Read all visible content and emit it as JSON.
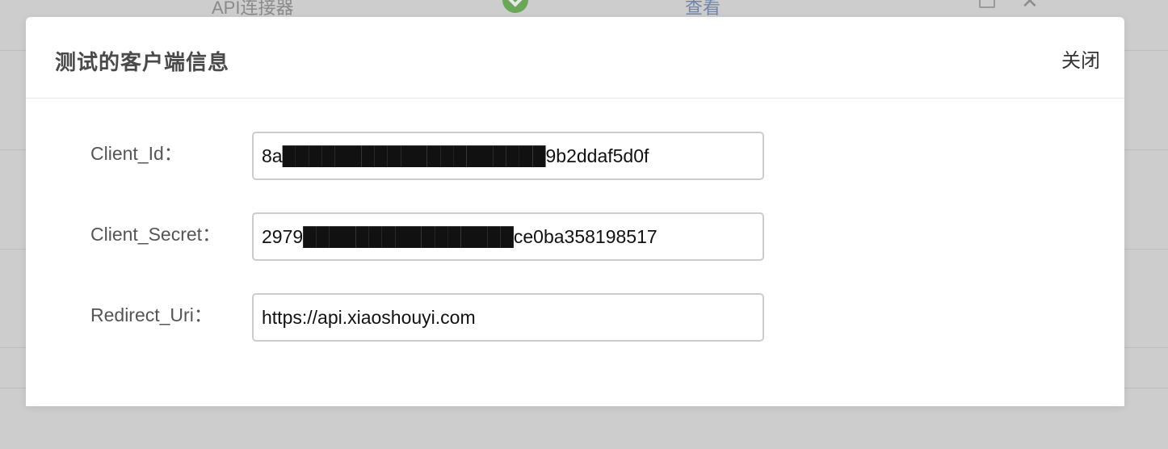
{
  "background": {
    "row_title": "API连接器",
    "row_link": "查看"
  },
  "modal": {
    "title": "测试的客户端信息",
    "close_label": "关闭",
    "fields": [
      {
        "label": "Client_Id：",
        "value": "8a████████████████████9b2ddaf5d0f"
      },
      {
        "label": "Client_Secret：",
        "value": "2979████████████████ce0ba358198517"
      },
      {
        "label": "Redirect_Uri：",
        "value": "https://api.xiaoshouyi.com"
      }
    ]
  }
}
